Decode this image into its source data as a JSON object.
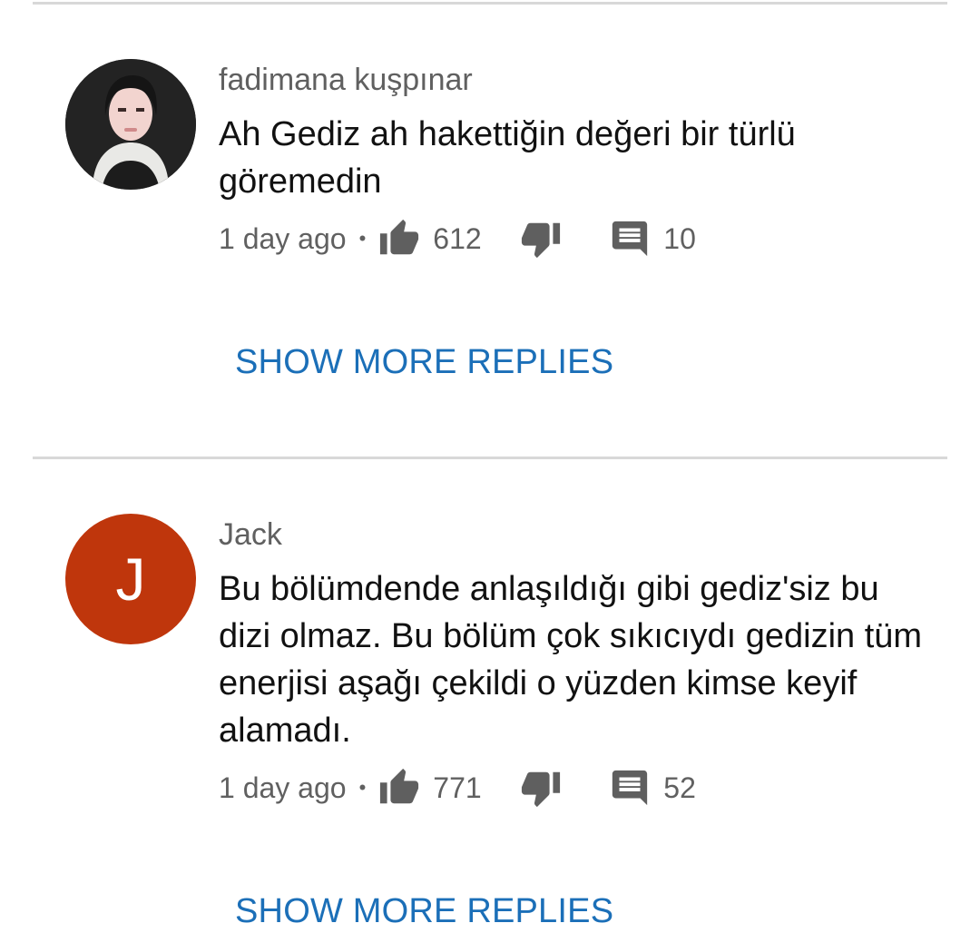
{
  "comments": [
    {
      "author": "fadimana kuşpınar",
      "text": "Ah Gediz ah hakettiğin değeri bir türlü göremedin",
      "time": "1 day ago",
      "separator": "•",
      "likes": "612",
      "replies": "10",
      "avatar": "profile-photo",
      "show_more": "SHOW MORE REPLIES"
    },
    {
      "author": "Jack",
      "text": "Bu bölümdende anlaşıldığı gibi gediz'siz bu dizi olmaz. Bu bölüm çok sıkıcıydı gedizin tüm enerjisi aşağı çekildi o yüzden kimse keyif alamadı.",
      "time": "1 day ago",
      "separator": "•",
      "likes": "771",
      "replies": "52",
      "avatar_letter": "J",
      "avatar_color": "#bf360c",
      "show_more": "SHOW MORE REPLIES"
    }
  ],
  "colors": {
    "link": "#1b6fb8",
    "meta": "#606060",
    "divider": "#d8d8d8"
  }
}
